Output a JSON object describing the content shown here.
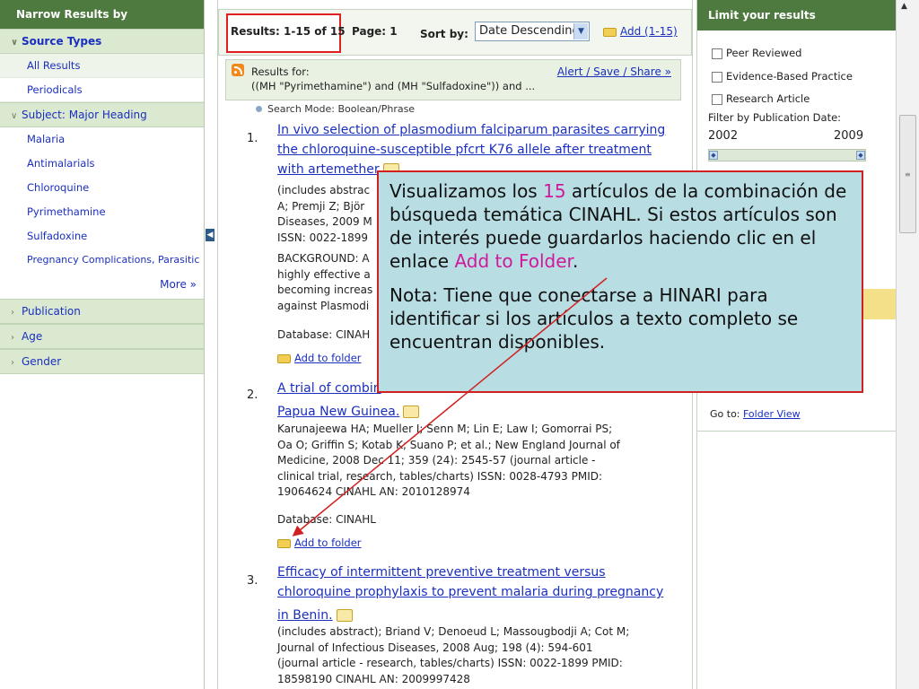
{
  "left": {
    "header": "Narrow Results by",
    "source_types": "Source Types",
    "items_source": [
      "All Results",
      "Periodicals"
    ],
    "subject": "Subject: Major Heading",
    "items_subject": [
      "Malaria",
      "Antimalarials",
      "Chloroquine",
      "Pyrimethamine",
      "Sulfadoxine",
      "Pregnancy Complications, Parasitic"
    ],
    "more": "More »",
    "sections": [
      "Publication",
      "Age",
      "Gender"
    ]
  },
  "toolbar": {
    "results": "Results: 1-15 of 15",
    "page": "Page: 1",
    "sort_label": "Sort by:",
    "sort_value": "Date Descending",
    "add": "Add (1-15)"
  },
  "rss": {
    "for": "Results for:",
    "query": "((MH \"Pyrimethamine\") and (MH \"Sulfadoxine\")) and ...",
    "alert": "Alert / Save / Share »",
    "mode": "Search Mode: Boolean/Phrase"
  },
  "results": [
    {
      "num": "1.",
      "title1": "In vivo selection of plasmodium falciparum parasites carrying",
      "title2": "the chloroquine-susceptible pfcrt K76 allele after treatment",
      "title3": "with artemether",
      "lines": [
        "(includes abstrac",
        "A; Premji Z; Björ",
        "Diseases, 2009 M",
        "ISSN: 0022-1899",
        "BACKGROUND: A",
        "highly effective a",
        "becoming increas",
        "against Plasmodi"
      ],
      "db": "Database: CINAH",
      "folder": "Add to folder"
    },
    {
      "num": "2.",
      "title1": "A trial of combin",
      "title2": "Papua New Guinea.",
      "lines": [
        "Karunajeewa HA; Mueller I; Senn M; Lin E; Law I; Gomorrai PS;",
        "Oa O; Griffin S; Kotab K; Suano P; et al.; New England Journal of",
        "Medicine, 2008 Dec 11; 359 (24): 2545-57 (journal article -",
        "clinical trial, research, tables/charts) ISSN: 0028-4793 PMID:",
        "19064624 CINAHL AN: 2010128974"
      ],
      "db": "Database: CINAHL",
      "folder": "Add to folder"
    },
    {
      "num": "3.",
      "title1": "Efficacy of intermittent preventive treatment versus",
      "title2": "chloroquine prophylaxis to prevent malaria during pregnancy",
      "title3": "in Benin.",
      "lines": [
        "(includes abstract); Briand V; Denoeud L; Massougbodji A; Cot M;",
        "Journal of Infectious Diseases, 2008 Aug; 198 (4): 594-601",
        "(journal article - research, tables/charts) ISSN: 0022-1899 PMID:",
        "18598190 CINAHL AN: 2009997428"
      ]
    }
  ],
  "right": {
    "header": "Limit your results",
    "checks": [
      "Peer Reviewed",
      "Evidence-Based Practice",
      "Research Article"
    ],
    "filter_label": "Filter by Publication Date:",
    "year_from": "2002",
    "year_to": "2009",
    "goto": "Go to:",
    "folder_view": "Folder View"
  },
  "callout": {
    "p1_a": "Visualizamos los ",
    "p1_num": "15",
    "p1_b": " artículos de la combinación de búsqueda temática CINAHL. Si estos artículos son de interés puede guardarlos haciendo clic en el enlace ",
    "p1_link": "Add to Folder",
    "p1_c": ".",
    "p2": "Nota: Tiene que conectarse a HINARI para identificar si los artículos a texto completo se encuentran disponibles."
  },
  "colors": {
    "accent_green": "#4f7a3f",
    "callout_bg": "#b8dde3",
    "callout_border": "#d02020",
    "highlight": "#d0199a"
  }
}
